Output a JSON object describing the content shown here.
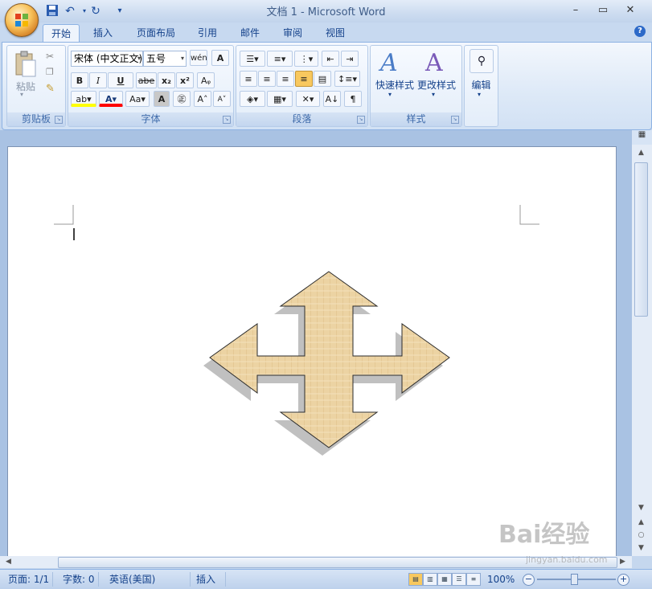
{
  "window": {
    "title": "文档 1 - Microsoft Word",
    "minimize": "–",
    "restore": "▭",
    "close": "✕"
  },
  "tabs": [
    {
      "label": "开始",
      "active": true
    },
    {
      "label": "插入"
    },
    {
      "label": "页面布局"
    },
    {
      "label": "引用"
    },
    {
      "label": "邮件"
    },
    {
      "label": "审阅"
    },
    {
      "label": "视图"
    }
  ],
  "ribbon": {
    "clipboard": {
      "label": "剪贴板",
      "paste": "粘贴"
    },
    "font": {
      "label": "字体",
      "font_name": "宋体 (中文正文)",
      "font_size": "五号",
      "bold": "B",
      "italic": "I",
      "underline": "U",
      "strike": "abe",
      "sub": "x₂",
      "sup": "x²",
      "change_case": "Aa"
    },
    "paragraph": {
      "label": "段落"
    },
    "styles": {
      "label": "样式",
      "quick_styles": "快速样式",
      "change_styles": "更改样式"
    },
    "editing": {
      "label": "编辑"
    }
  },
  "status": {
    "page": "页面: 1/1",
    "words": "字数: 0",
    "language": "英语(美国)",
    "mode": "插入",
    "zoom": "100%"
  },
  "watermark": {
    "brand": "Bai经验",
    "url": "jingyan.baidu.com"
  },
  "colors": {
    "accent": "#15428b",
    "shape_fill": "#ecd3a3",
    "highlight": "#ffff00",
    "font_color": "#ff0000"
  }
}
